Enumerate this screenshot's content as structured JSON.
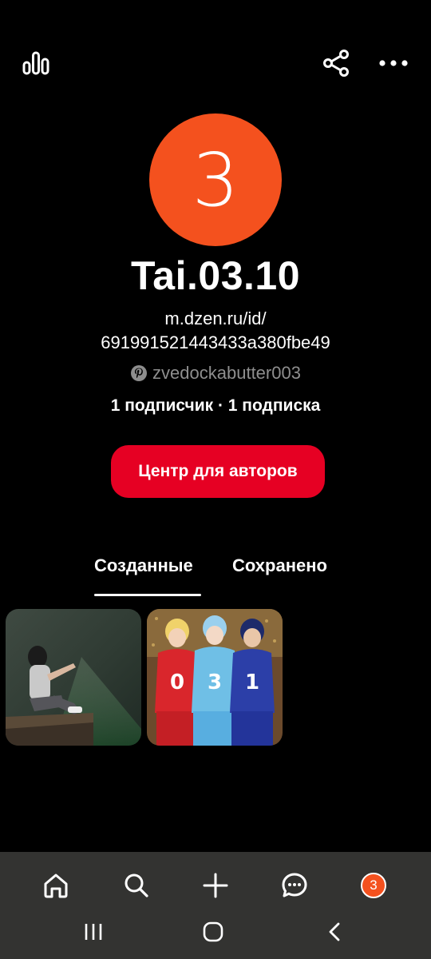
{
  "header": {
    "stats_icon": "bar-chart-icon",
    "share_icon": "share-icon",
    "more_icon": "more-dots-icon"
  },
  "profile": {
    "avatar_letter": "3",
    "avatar_color": "#f4511e",
    "username": "Tai.03.10",
    "url_line1": "m.dzen.ru/id/",
    "url_line2": "691991521443433a380fbe49",
    "pinterest_handle": "zvedockabutter003",
    "counts": "1 подписчик · 1 подписка"
  },
  "creator_button": {
    "label": "Центр для авторов",
    "color": "#e60023"
  },
  "tabs": [
    {
      "label": "Созданные",
      "active": true
    },
    {
      "label": "Сохранено",
      "active": false
    }
  ],
  "pins": [
    {
      "name": "boy-sitting-on-ledge"
    },
    {
      "name": "three-basketball-players"
    }
  ],
  "bottom_nav": {
    "items": [
      "home-icon",
      "search-icon",
      "plus-icon",
      "messages-icon",
      "profile-avatar"
    ],
    "profile_letter": "3"
  },
  "system_nav": {
    "items": [
      "recents-icon",
      "home-icon",
      "back-icon"
    ]
  }
}
